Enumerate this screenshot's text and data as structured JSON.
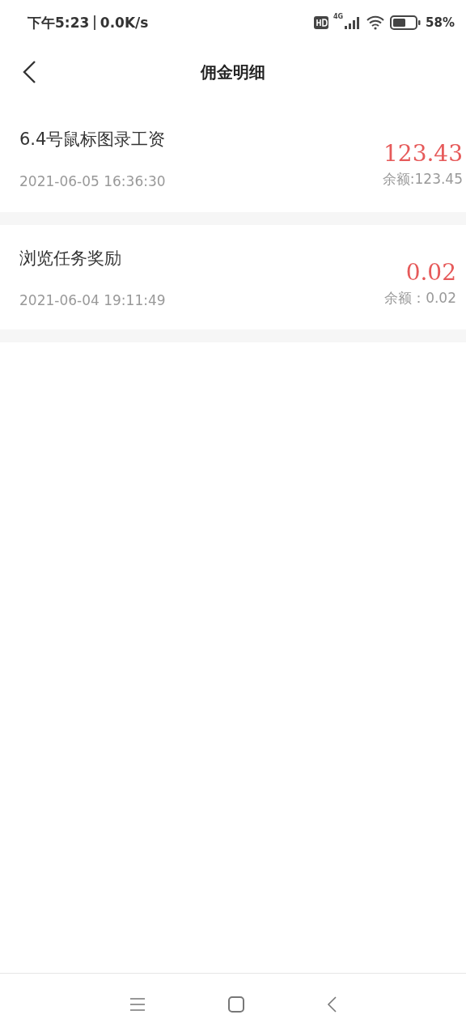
{
  "status_bar": {
    "time": "下午5:23",
    "speed": "0.0K/s",
    "network": "4G",
    "battery": "58%"
  },
  "header": {
    "title": "佣金明细"
  },
  "records": [
    {
      "title": "6.4号鼠标图录工资",
      "time": "2021-06-05 16:36:30",
      "amount": "123.43",
      "balance": "余额:123.45"
    },
    {
      "title": "浏览任务奖励",
      "time": "2021-06-04 19:11:49",
      "amount": "0.02",
      "balance": "余额：0.02"
    }
  ]
}
